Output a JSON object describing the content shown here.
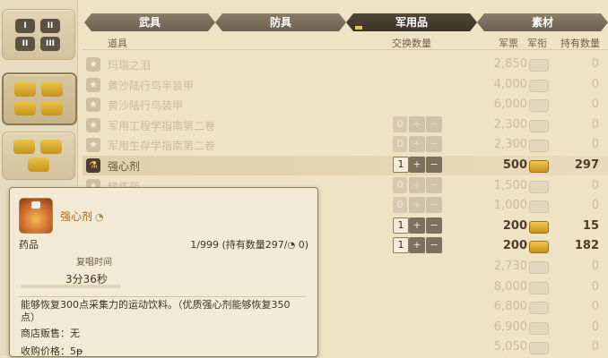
{
  "tabs": [
    {
      "label": "武具"
    },
    {
      "label": "防具"
    },
    {
      "label": "军用品",
      "active": true
    },
    {
      "label": "素材"
    }
  ],
  "header": {
    "item": "道具",
    "exchange_qty": "交换数量",
    "seal": "军票",
    "rank": "军衔",
    "owned": "持有数量"
  },
  "rows": [
    {
      "name": "玛瑙之泪",
      "icon": "grey-star",
      "price": "2,850",
      "owned": "0",
      "stepper": false,
      "active": false,
      "highlight": false
    },
    {
      "name": "黄沙陆行鸟半装甲",
      "icon": "grey-star",
      "price": "4,000",
      "owned": "0",
      "stepper": false,
      "active": false,
      "highlight": false
    },
    {
      "name": "黄沙陆行鸟装甲",
      "icon": "grey-star",
      "price": "6,000",
      "owned": "0",
      "stepper": false,
      "active": false,
      "highlight": false
    },
    {
      "name": "军用工程学指南第二卷",
      "icon": "grey-star",
      "price": "2,300",
      "owned": "0",
      "stepper": true,
      "qty": "0",
      "active": false,
      "highlight": false
    },
    {
      "name": "军用生存学指南第二卷",
      "icon": "grey-star",
      "price": "2,300",
      "owned": "0",
      "stepper": true,
      "qty": "0",
      "active": false,
      "highlight": false
    },
    {
      "name": "强心剂",
      "icon": "potion",
      "price": "500",
      "owned": "297",
      "stepper": true,
      "qty": "1",
      "active": true,
      "highlight": true
    },
    {
      "name": "精炼药",
      "icon": "grey-star",
      "price": "1,500",
      "owned": "0",
      "stepper": true,
      "qty": "0",
      "active": false,
      "highlight": false
    },
    {
      "name": "",
      "icon": "grey-star",
      "price": "1,000",
      "owned": "0",
      "stepper": true,
      "qty": "0",
      "active": false,
      "highlight": false
    },
    {
      "name": "",
      "icon": "grey-star",
      "price": "200",
      "owned": "15",
      "stepper": true,
      "qty": "1",
      "active": true,
      "highlight": false
    },
    {
      "name": "",
      "icon": "grey-star",
      "price": "200",
      "owned": "182",
      "stepper": true,
      "qty": "1",
      "active": true,
      "highlight": false
    },
    {
      "name": "",
      "icon": "grey-star",
      "price": "2,730",
      "owned": "0",
      "stepper": false,
      "active": false,
      "highlight": false
    },
    {
      "name": "",
      "icon": "grey-star",
      "price": "8,000",
      "owned": "0",
      "stepper": false,
      "active": false,
      "highlight": false
    },
    {
      "name": "",
      "icon": "grey-star",
      "price": "6,800",
      "owned": "0",
      "stepper": false,
      "active": false,
      "highlight": false
    },
    {
      "name": "",
      "icon": "grey-star",
      "price": "6,900",
      "owned": "0",
      "stepper": false,
      "active": false,
      "highlight": false
    },
    {
      "name": "",
      "icon": "grey-star",
      "price": "5,050",
      "owned": "0",
      "stepper": false,
      "active": false,
      "highlight": false
    }
  ],
  "rail": [
    {
      "icons": [
        "I",
        "II",
        "III"
      ],
      "gold": false,
      "selected": false
    },
    {
      "icons": [
        "rank1",
        "rank2",
        "rank3",
        "rank4"
      ],
      "gold": true,
      "selected": true
    },
    {
      "icons": [
        "rank5",
        "rank6",
        "rank7"
      ],
      "gold": true,
      "selected": false
    }
  ],
  "detail": {
    "name": "强心剂",
    "category": "药品",
    "count": "1/999 (持有数量297/",
    "count_tail": " 0)",
    "recast_label": "复唱时间",
    "recast_value": "3分36秒",
    "description": "能够恢复300点采集力的运动饮料。（优质强心剂能够恢复350点）",
    "shop": "商店贩售：无",
    "buy_price": "收购价格：5",
    "buy_suffix": "ᵽ"
  },
  "colors": {
    "accent_gold": "#e9c24a",
    "tab_active": "#3b3328",
    "highlight_text": "#b06a1a"
  }
}
